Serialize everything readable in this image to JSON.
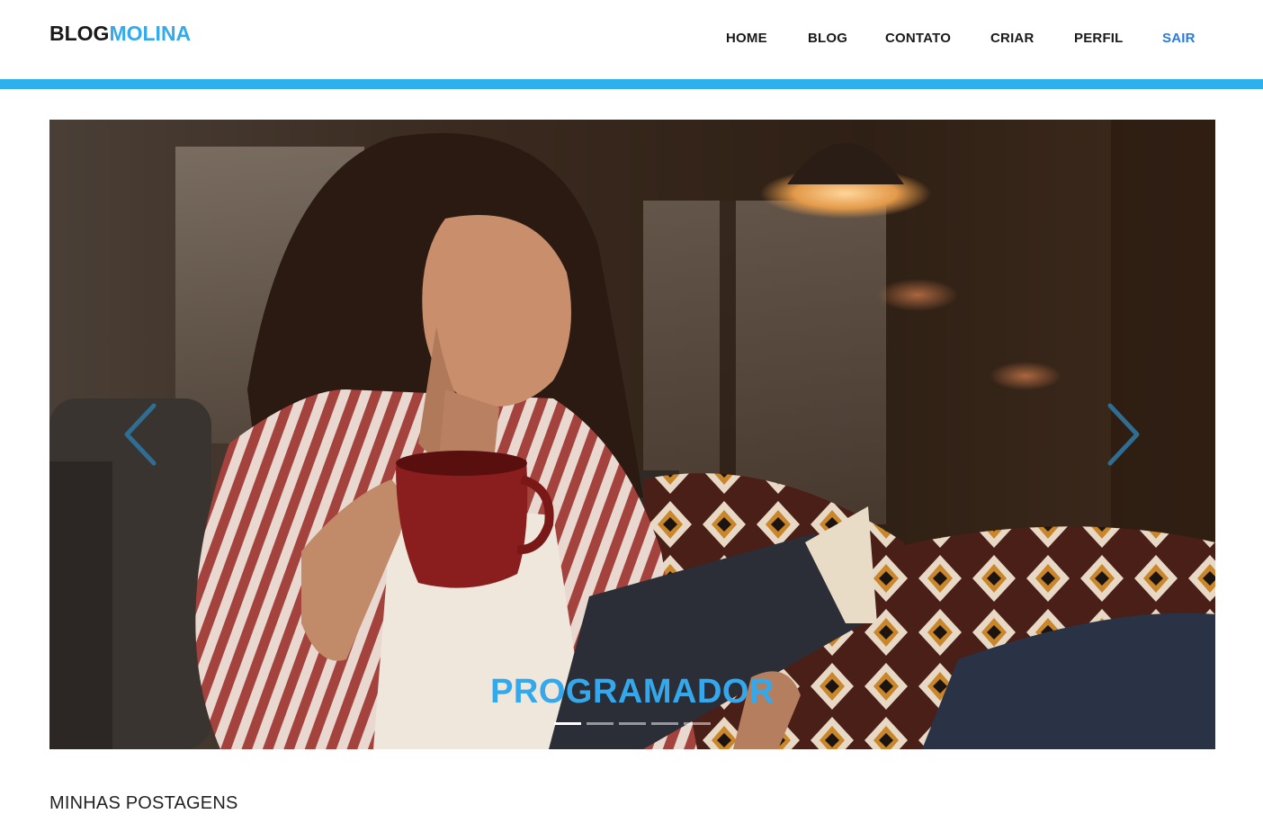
{
  "header": {
    "logo_part1": "BLOG",
    "logo_part2": "MOLINA",
    "nav": [
      {
        "label": "HOME"
      },
      {
        "label": "BLOG"
      },
      {
        "label": "CONTATO"
      },
      {
        "label": "CRIAR"
      },
      {
        "label": "PERFIL"
      },
      {
        "label": "SAIR",
        "active": true
      }
    ]
  },
  "colors": {
    "accent": "#2eb0ee",
    "logo_blue": "#33aaee",
    "active_link": "#2a7be0",
    "caption": "#34a8ec",
    "text_dark": "#1a1a1a"
  },
  "carousel": {
    "caption": "PROGRAMADOR",
    "slide_count": 5,
    "active_slide": 1,
    "prev_icon": "chevron-left-icon",
    "next_icon": "chevron-right-icon"
  },
  "main": {
    "section_title": "MINHAS POSTAGENS"
  }
}
